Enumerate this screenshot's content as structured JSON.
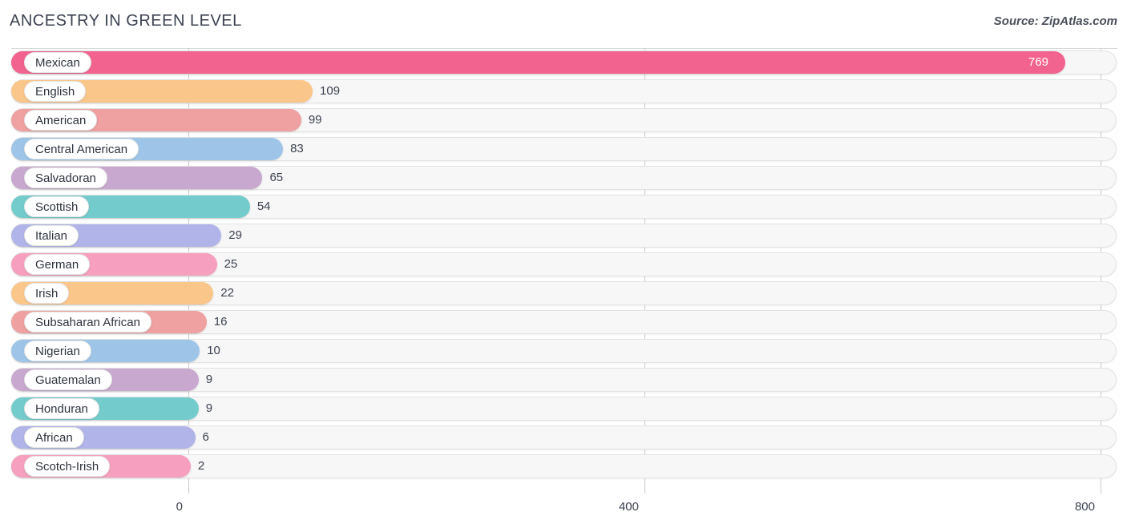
{
  "header": {
    "title": "ANCESTRY IN GREEN LEVEL",
    "source": "Source: ZipAtlas.com"
  },
  "chart_data": {
    "type": "bar",
    "orientation": "horizontal",
    "title": "ANCESTRY IN GREEN LEVEL",
    "subtitle": "",
    "xlabel": "",
    "ylabel": "",
    "xlim": [
      0,
      800
    ],
    "xticks": [
      0,
      400,
      800
    ],
    "xtick_labels": [
      "0",
      "400",
      "800"
    ],
    "grid": true,
    "legend": "none",
    "categories": [
      "Mexican",
      "English",
      "American",
      "Central American",
      "Salvadoran",
      "Scottish",
      "Italian",
      "German",
      "Irish",
      "Subsaharan African",
      "Nigerian",
      "Guatemalan",
      "Honduran",
      "African",
      "Scotch-Irish"
    ],
    "values": [
      769,
      109,
      99,
      83,
      65,
      54,
      29,
      25,
      22,
      16,
      10,
      9,
      9,
      6,
      2
    ],
    "value_labels": [
      "769",
      "109",
      "99",
      "83",
      "65",
      "54",
      "29",
      "25",
      "22",
      "16",
      "10",
      "9",
      "9",
      "6",
      "2"
    ],
    "colors": [
      "#f2638f",
      "#fbc68a",
      "#efa0a0",
      "#9ec5e8",
      "#c8a8ce",
      "#74cbcb",
      "#b0b4e8",
      "#f79fbe",
      "#fbc68a",
      "#efa0a0",
      "#9ec5e8",
      "#c8a8ce",
      "#74cbcb",
      "#b0b4e8",
      "#f79fbe"
    ]
  }
}
